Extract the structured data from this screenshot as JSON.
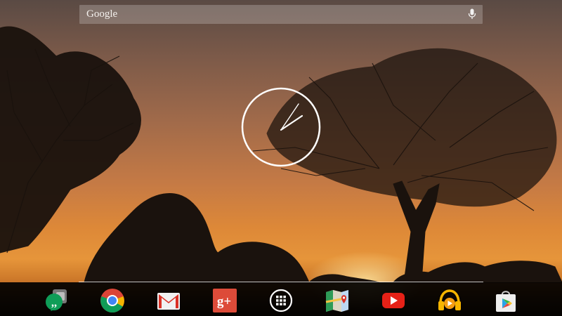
{
  "search": {
    "label": "Google",
    "mic_icon": "microphone-icon"
  },
  "clock": {
    "type": "analog",
    "color": "#ffffff"
  },
  "dock": {
    "apps": [
      {
        "name": "Hangouts",
        "icon": "hangouts-icon"
      },
      {
        "name": "Chrome",
        "icon": "chrome-icon"
      },
      {
        "name": "Gmail",
        "icon": "gmail-icon"
      },
      {
        "name": "Google+",
        "icon": "google-plus-icon",
        "glyph": "g+"
      },
      {
        "name": "Apps",
        "icon": "app-drawer-icon"
      },
      {
        "name": "Maps",
        "icon": "maps-icon"
      },
      {
        "name": "YouTube",
        "icon": "youtube-icon"
      },
      {
        "name": "Play Music",
        "icon": "play-music-icon"
      },
      {
        "name": "Play Store",
        "icon": "play-store-icon"
      }
    ]
  },
  "colors": {
    "sky_top": "#5a4a44",
    "sky_glow": "#e6953a",
    "dock_bg": "#000000"
  }
}
